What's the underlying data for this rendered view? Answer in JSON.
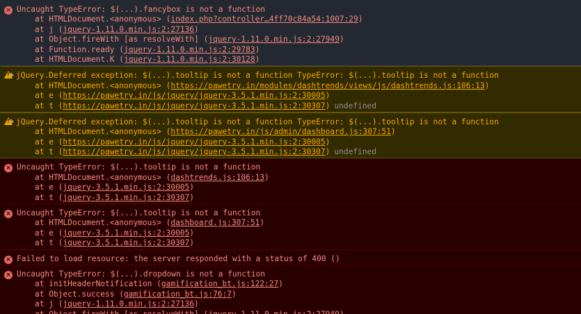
{
  "messages": [
    {
      "level": "error",
      "style": "plain",
      "text": "Uncaught TypeError: $(...).fancybox is not a function",
      "stack": [
        {
          "prefix": "at HTMLDocument.<anonymous> (",
          "link": "index.php?controller…4ff70c84a54:1007:29",
          "suffix": ")"
        },
        {
          "prefix": "at j (",
          "link": "jquery-1.11.0.min.js:2:27136",
          "suffix": ")"
        },
        {
          "prefix": "at Object.fireWith [as resolveWith] (",
          "link": "jquery-1.11.0.min.js:2:27949",
          "suffix": ")"
        },
        {
          "prefix": "at Function.ready (",
          "link": "jquery-1.11.0.min.js:2:29783",
          "suffix": ")"
        },
        {
          "prefix": "at HTMLDocument.K (",
          "link": "jquery-1.11.0.min.js:2:30128",
          "suffix": ")"
        }
      ]
    },
    {
      "level": "warning",
      "text": "jQuery.Deferred exception: $(...).tooltip is not a function TypeError: $(...).tooltip is not a function",
      "stack": [
        {
          "prefix": "at HTMLDocument.<anonymous> (",
          "link": "https://pawetry.in/modules/dashtrends/views/js/dashtrends.js:106:13",
          "suffix": ")"
        },
        {
          "prefix": "at e (",
          "link": "https://pawetry.in/js/jquery/jquery-3.5.1.min.js:2:30005",
          "suffix": ")"
        },
        {
          "prefix": "at t (",
          "link": "https://pawetry.in/js/jquery/jquery-3.5.1.min.js:2:30307",
          "suffix": ")",
          "extra": "undefined"
        }
      ]
    },
    {
      "level": "warning",
      "text": "jQuery.Deferred exception: $(...).tooltip is not a function TypeError: $(...).tooltip is not a function",
      "stack": [
        {
          "prefix": "at HTMLDocument.<anonymous> (",
          "link": "https://pawetry.in/js/admin/dashboard.js:307:51",
          "suffix": ")"
        },
        {
          "prefix": "at e (",
          "link": "https://pawetry.in/js/jquery/jquery-3.5.1.min.js:2:30005",
          "suffix": ")"
        },
        {
          "prefix": "at t (",
          "link": "https://pawetry.in/js/jquery/jquery-3.5.1.min.js:2:30307",
          "suffix": ")",
          "extra": "undefined"
        }
      ]
    },
    {
      "level": "error",
      "text": "Uncaught TypeError: $(...).tooltip is not a function",
      "stack": [
        {
          "prefix": "at HTMLDocument.<anonymous> (",
          "link": "dashtrends.js:106:13",
          "suffix": ")"
        },
        {
          "prefix": "at e (",
          "link": "jquery-3.5.1.min.js:2:30005",
          "suffix": ")"
        },
        {
          "prefix": "at t (",
          "link": "jquery-3.5.1.min.js:2:30307",
          "suffix": ")"
        }
      ]
    },
    {
      "level": "error",
      "text": "Uncaught TypeError: $(...).tooltip is not a function",
      "stack": [
        {
          "prefix": "at HTMLDocument.<anonymous> (",
          "link": "dashboard.js:307:51",
          "suffix": ")"
        },
        {
          "prefix": "at e (",
          "link": "jquery-3.5.1.min.js:2:30005",
          "suffix": ")"
        },
        {
          "prefix": "at t (",
          "link": "jquery-3.5.1.min.js:2:30307",
          "suffix": ")"
        }
      ]
    },
    {
      "level": "error",
      "text": "Failed to load resource: the server responded with a status of 400 ()",
      "stack": []
    },
    {
      "level": "error",
      "text": "Uncaught TypeError: $(...).dropdown is not a function",
      "stack": [
        {
          "prefix": "at initHeaderNotification (",
          "link": "gamification_bt.js:122:27",
          "suffix": ")"
        },
        {
          "prefix": "at Object.success (",
          "link": "gamification_bt.js:76:7",
          "suffix": ")"
        },
        {
          "prefix": "at j (",
          "link": "jquery-1.11.0.min.js:2:27136",
          "suffix": ")"
        },
        {
          "prefix": "at Object.fireWith [as resolveWith] (",
          "link": "jquery-1.11.0.min.js:2:27949",
          "suffix": ")"
        }
      ]
    }
  ],
  "icons": {
    "error": "error-circle-icon",
    "warning": "warning-triangle-icon"
  },
  "colors": {
    "error_text": "#f28b82",
    "warning_text": "#f2a600",
    "error_bg": "#290000",
    "warning_bg": "#332b00",
    "neutral_bg": "#242830"
  }
}
